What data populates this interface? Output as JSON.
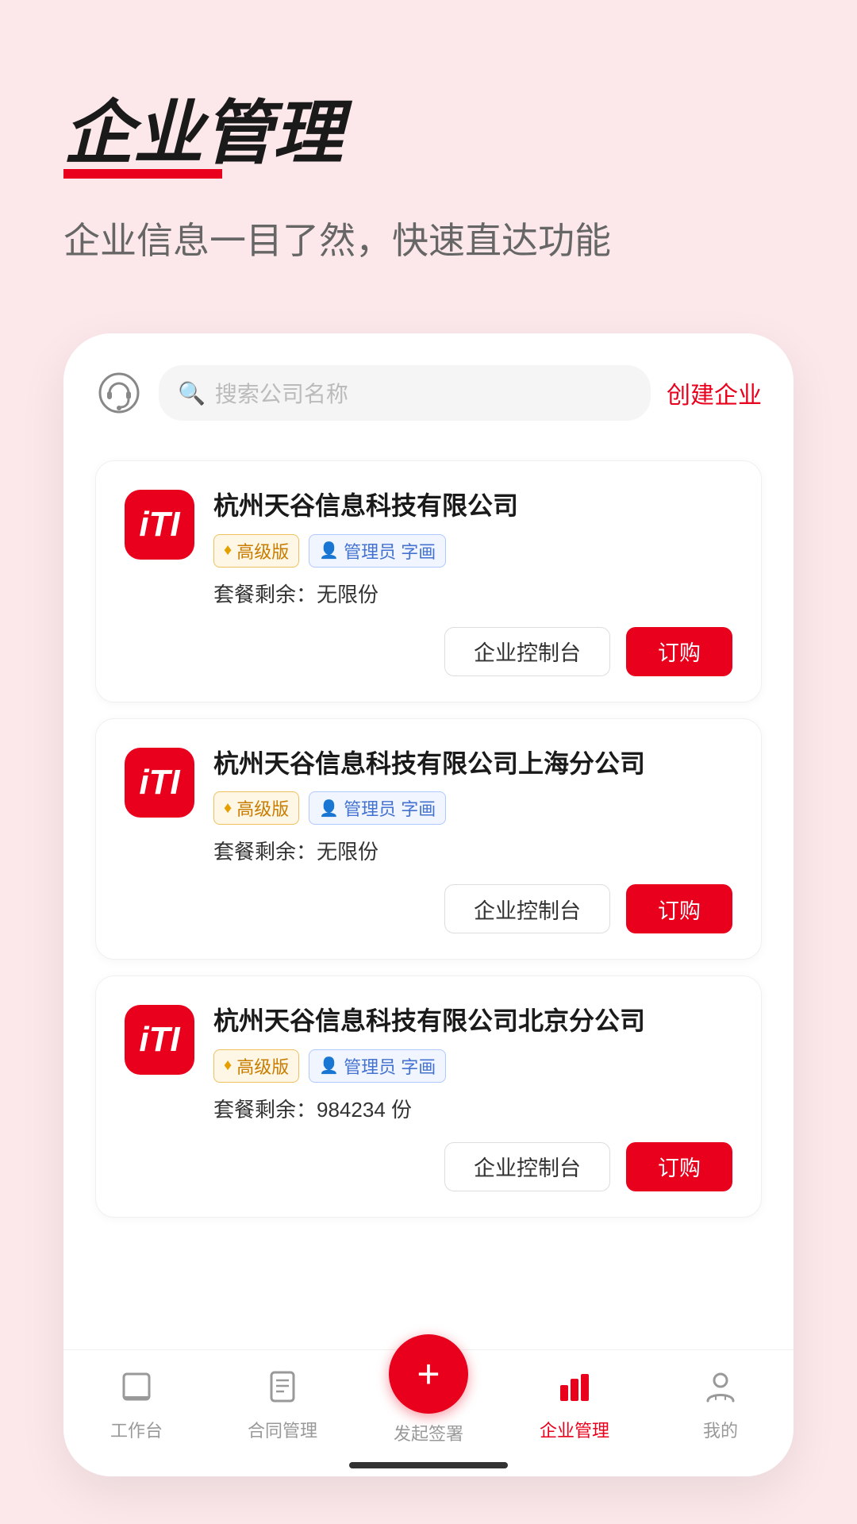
{
  "header": {
    "title": "企业管理",
    "subtitle": "企业信息一目了然，快速直达功能",
    "title_underline_color": "#e8001c"
  },
  "search": {
    "placeholder": "搜索公司名称",
    "create_label": "创建企业"
  },
  "companies": [
    {
      "id": 1,
      "name": "杭州天谷信息科技有限公司",
      "logo_text": "iTI",
      "tier_label": "高级版",
      "admin_label": "管理员 字画",
      "quota_label": "套餐剩余：",
      "quota_value": "无限份",
      "control_btn": "企业控制台",
      "order_btn": "订购"
    },
    {
      "id": 2,
      "name": "杭州天谷信息科技有限公司上海分公司",
      "logo_text": "iTI",
      "tier_label": "高级版",
      "admin_label": "管理员 字画",
      "quota_label": "套餐剩余：",
      "quota_value": "无限份",
      "control_btn": "企业控制台",
      "order_btn": "订购"
    },
    {
      "id": 3,
      "name": "杭州天谷信息科技有限公司北京分公司",
      "logo_text": "iTI",
      "tier_label": "高级版",
      "admin_label": "管理员 字画",
      "quota_label": "套餐剩余：",
      "quota_value": "984234 份",
      "control_btn": "企业控制台",
      "order_btn": "订购"
    }
  ],
  "nav": {
    "items": [
      {
        "id": "workbench",
        "label": "工作台",
        "icon": "□",
        "active": false
      },
      {
        "id": "contract",
        "label": "合同管理",
        "icon": "≡",
        "active": false
      },
      {
        "id": "sign",
        "label": "发起签署",
        "icon": "+",
        "center": true,
        "active": false
      },
      {
        "id": "enterprise",
        "label": "企业管理",
        "icon": "📊",
        "active": true
      },
      {
        "id": "mine",
        "label": "我的",
        "icon": "○",
        "active": false
      }
    ]
  },
  "colors": {
    "accent": "#e8001c",
    "premium": "#c87c00",
    "admin_blue": "#4472d0",
    "bg": "#fce8ea"
  }
}
